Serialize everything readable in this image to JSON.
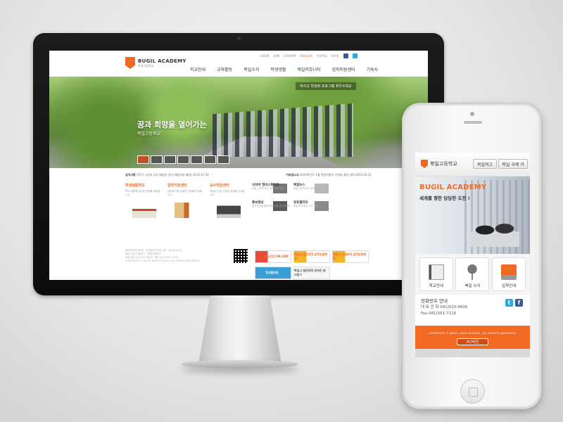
{
  "desktop": {
    "top_links": [
      "LOGIN",
      "JOIN",
      "SITEMAP",
      "ENGLISH",
      "북일학교",
      "모바일"
    ],
    "logo": {
      "name": "BUGIL ACADEMY",
      "sub": "북일고등학교"
    },
    "nav": [
      "학교안내",
      "교육활동",
      "북일소식",
      "학생생활",
      "북일커뮤니티",
      "입학지원센터",
      "기숙사"
    ],
    "hero": {
      "badge": "자사고 학생화 프로그램 최우수학교",
      "slogan": "꿈과 희망을 열어가는",
      "sub": "북일고등학교"
    },
    "notice": {
      "label": "공지사항",
      "text": "2학기 시간표 공유 배정일 안내 (9월 6일 배정)",
      "date": "2015.07.30",
      "label2": "기숙생소식",
      "text2": "2015학년도 1월 북일학원추 수업비 결정 내역",
      "date2": "2015.05.31"
    },
    "sections": [
      {
        "title": "학생생활학도",
        "desc": "학교 생활에 유익한 정보를 제공합니다"
      },
      {
        "title": "입학지원센터",
        "desc": "입학에 관한 유용한 정보를 안내합니다"
      },
      {
        "title": "교수학습센터",
        "desc": "학습에 관한 다양한 정보를 안내합니다"
      }
    ],
    "news": [
      {
        "title": "사이버 영어스튜디오",
        "desc": "북일 고등학교의 영어 학습 공간"
      },
      {
        "title": "북일뉴스",
        "desc": "북일고등학교의 생생한 소식"
      },
      {
        "title": "홍보영상",
        "desc": "홍보영상을 통해 북일고를 만나보세요"
      },
      {
        "title": "포토갤러리",
        "desc": "북일학교 행사 사진 모음"
      }
    ],
    "footer": [
      "개인정보처리방침 · 이메일무단수집거부 · 찾아오시는길",
      "충남 천안시 동남구 · 북일고등학교",
      "대표전화 041)520-9600 · 팩스 041)551-7116",
      "COPYRIGHT © BUGIL HIGH SCHOOL. ALL RIGHTS RESERVED."
    ],
    "banners": [
      "급식신청 ON-LINE",
      "북일고 일반과정 입학상담예약",
      "북일고 국제과정 입학상담예약",
      "학교알리미",
      "북일고 일반과정 온라인 원서접수",
      ""
    ]
  },
  "mobile": {
    "logo": "북일고등학교",
    "btn1": "북일여고",
    "btn2": "북일 국제 과",
    "hero_title": "BUGIL ACADEMY",
    "hero_sub": "세계를 향한 당당한 도전 !",
    "icons": [
      "학교안내",
      "북일 소식",
      "입학안내"
    ],
    "contact_title": "전화번호 안내",
    "contact_main": "대 표 전 화 041)520-9600",
    "contact_fax": "Fax 041)551-7116",
    "copyright": "COPYRIGHT © BUGIL HIGH SCHOOL. ALL RIGHTS RESERVED.",
    "pc_button": "PC버전",
    "colors": {
      "accent": "#f26a21",
      "twitter": "#2ba9e1",
      "facebook": "#3b5998"
    }
  }
}
